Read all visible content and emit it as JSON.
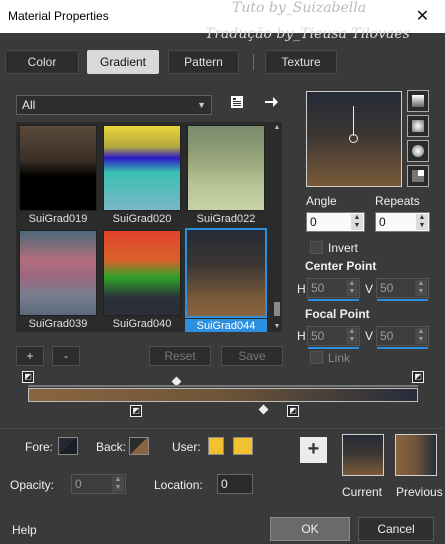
{
  "window": {
    "title": "Material Properties",
    "close": "✕"
  },
  "watermark": {
    "line1": "Tuto by_Suizabella",
    "line2": "Tradução by_Tieusa Tilovaes"
  },
  "tabs": [
    {
      "label": "Color",
      "active": false
    },
    {
      "label": "Gradient",
      "active": true
    },
    {
      "label": "Pattern",
      "active": false
    },
    {
      "label": "Texture",
      "active": false
    }
  ],
  "category": {
    "selected": "All"
  },
  "gallery": {
    "items": [
      {
        "name": "SuiGrad019",
        "colors": [
          "#5a4a3c",
          "#3b3027",
          "#000000",
          "#000000"
        ]
      },
      {
        "name": "SuiGrad020",
        "colors": [
          "#ecd73a",
          "#2b18c6",
          "#39c0b0",
          "#7bb7c8"
        ]
      },
      {
        "name": "SuiGrad022",
        "colors": [
          "#788a6c",
          "#99a57a",
          "#b6c496",
          "#c7d3a6"
        ]
      },
      {
        "name": "SuiGrad039",
        "colors": [
          "#b46d7b",
          "#9a6880",
          "#7c7d8f",
          "#5a6a7a"
        ]
      },
      {
        "name": "SuiGrad040",
        "colors": [
          "#e2432c",
          "#d9622a",
          "#2fa12a",
          "#2a2f3a"
        ]
      },
      {
        "name": "SuiGrad044",
        "colors": [
          "#252a37",
          "#3b3633",
          "#7a5a39",
          "#8a6540"
        ],
        "selected": true
      }
    ]
  },
  "actions": {
    "add": "+",
    "remove": "-",
    "reset": "Reset",
    "save": "Save"
  },
  "angle": {
    "label": "Angle",
    "value": "0"
  },
  "repeats": {
    "label": "Repeats",
    "value": "0"
  },
  "invert": {
    "label": "Invert",
    "checked": false
  },
  "center_point": {
    "label": "Center Point",
    "h_label": "H",
    "h": "50",
    "v_label": "V",
    "v": "50"
  },
  "focal_point": {
    "label": "Focal Point",
    "h_label": "H",
    "h": "50",
    "v_label": "V",
    "v": "50"
  },
  "link": {
    "label": "Link",
    "checked": false
  },
  "fore": {
    "label": "Fore:"
  },
  "back": {
    "label": "Back:"
  },
  "user": {
    "label": "User:",
    "color": "#f0c230"
  },
  "opacity": {
    "label": "Opacity:",
    "value": "0"
  },
  "location": {
    "label": "Location:",
    "value": "0"
  },
  "current": {
    "label": "Current"
  },
  "previous": {
    "label": "Previous"
  },
  "footer": {
    "help": "Help",
    "ok": "OK",
    "cancel": "Cancel"
  },
  "colors": {
    "accent": "#2d8fe0",
    "background": "#3a3a3a"
  }
}
